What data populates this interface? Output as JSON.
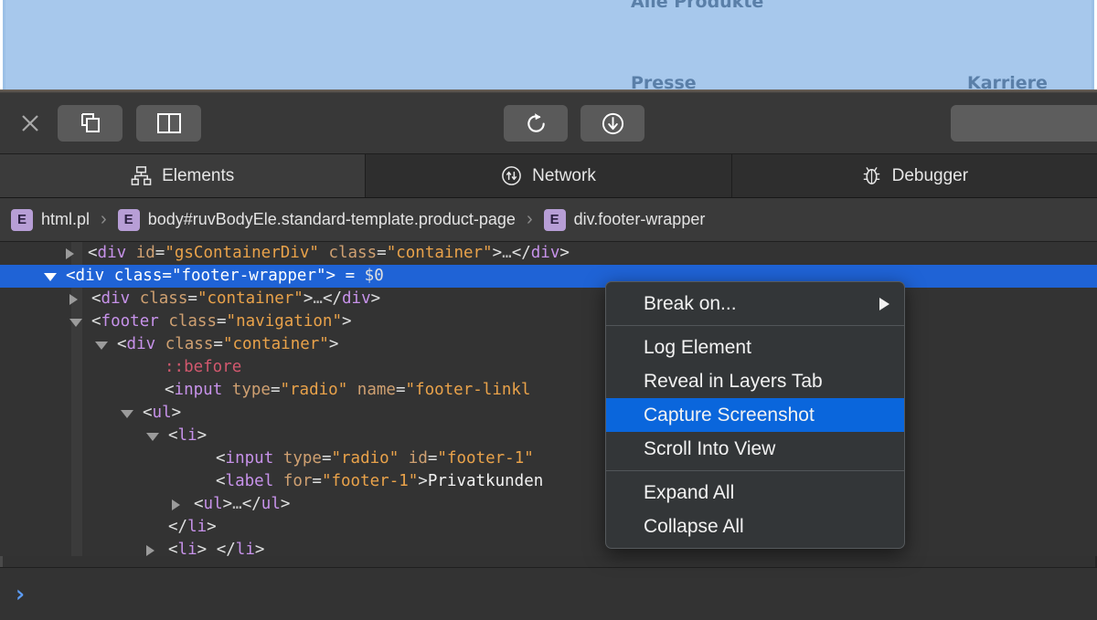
{
  "page": {
    "highlight_color": "#a7c8ec",
    "links": [
      {
        "label": "Alle Produkte"
      },
      {
        "label": "Presse"
      },
      {
        "label": "Karriere"
      }
    ]
  },
  "toolbar": {
    "close_label": "close-inspector",
    "dock_right_label": "dock-to-side",
    "dock_bottom_label": "dock-to-bottom",
    "reload_label": "reload-page",
    "download_label": "download-web-archive",
    "search_value": "",
    "search_placeholder": ""
  },
  "tabs": [
    {
      "label": "Elements",
      "icon": "elements-tree-icon",
      "active": true
    },
    {
      "label": "Network",
      "icon": "network-arrows-icon",
      "active": false
    },
    {
      "label": "Debugger",
      "icon": "bug-icon",
      "active": false
    }
  ],
  "breadcrumb": {
    "badge": "E",
    "items": [
      {
        "label": "html.pl"
      },
      {
        "label": "body#ruvBodyEle.standard-template.product-page"
      },
      {
        "label": "div.footer-wrapper"
      }
    ],
    "separator": "›"
  },
  "dom_tree": {
    "rows": [
      {
        "indent": 96,
        "twisty": "closed",
        "selected": false,
        "segments": [
          {
            "t": "punct",
            "v": "<"
          },
          {
            "t": "tag",
            "v": "div"
          },
          {
            "t": "punct",
            "v": " "
          },
          {
            "t": "attr",
            "v": "id"
          },
          {
            "t": "punct",
            "v": "="
          },
          {
            "t": "val",
            "v": "\"gsContainerDiv\""
          },
          {
            "t": "punct",
            "v": " "
          },
          {
            "t": "attr",
            "v": "class"
          },
          {
            "t": "punct",
            "v": "="
          },
          {
            "t": "val",
            "v": "\"container\""
          },
          {
            "t": "punct",
            "v": ">"
          },
          {
            "t": "ellip",
            "v": "…"
          },
          {
            "t": "punct",
            "v": "</"
          },
          {
            "t": "tag",
            "v": "div"
          },
          {
            "t": "punct",
            "v": ">"
          }
        ]
      },
      {
        "indent": 72,
        "twisty": "open",
        "selected": true,
        "segments": [
          {
            "t": "punct",
            "v": "<"
          },
          {
            "t": "tag",
            "v": "div"
          },
          {
            "t": "punct",
            "v": " "
          },
          {
            "t": "attr",
            "v": "class"
          },
          {
            "t": "punct",
            "v": "="
          },
          {
            "t": "val",
            "v": "\"footer-wrapper\""
          },
          {
            "t": "punct",
            "v": "> = "
          },
          {
            "t": "dollar",
            "v": "$0"
          }
        ]
      },
      {
        "indent": 100,
        "twisty": "closed",
        "selected": false,
        "segments": [
          {
            "t": "punct",
            "v": "<"
          },
          {
            "t": "tag",
            "v": "div"
          },
          {
            "t": "punct",
            "v": " "
          },
          {
            "t": "attr",
            "v": "class"
          },
          {
            "t": "punct",
            "v": "="
          },
          {
            "t": "val",
            "v": "\"container\""
          },
          {
            "t": "punct",
            "v": ">"
          },
          {
            "t": "ellip",
            "v": "…"
          },
          {
            "t": "punct",
            "v": "</"
          },
          {
            "t": "tag",
            "v": "div"
          },
          {
            "t": "punct",
            "v": ">"
          }
        ]
      },
      {
        "indent": 100,
        "twisty": "open",
        "selected": false,
        "segments": [
          {
            "t": "punct",
            "v": "<"
          },
          {
            "t": "tag",
            "v": "footer"
          },
          {
            "t": "punct",
            "v": " "
          },
          {
            "t": "attr",
            "v": "class"
          },
          {
            "t": "punct",
            "v": "="
          },
          {
            "t": "val",
            "v": "\"navigation\""
          },
          {
            "t": "punct",
            "v": ">"
          }
        ]
      },
      {
        "indent": 128,
        "twisty": "open",
        "selected": false,
        "segments": [
          {
            "t": "punct",
            "v": "<"
          },
          {
            "t": "tag",
            "v": "div"
          },
          {
            "t": "punct",
            "v": " "
          },
          {
            "t": "attr",
            "v": "class"
          },
          {
            "t": "punct",
            "v": "="
          },
          {
            "t": "val",
            "v": "\"container\""
          },
          {
            "t": "punct",
            "v": ">"
          }
        ]
      },
      {
        "indent": 180,
        "twisty": "none",
        "selected": false,
        "segments": [
          {
            "t": "pseudo",
            "v": "::before"
          }
        ]
      },
      {
        "indent": 180,
        "twisty": "none",
        "selected": false,
        "segments": [
          {
            "t": "punct",
            "v": "<"
          },
          {
            "t": "tag",
            "v": "input"
          },
          {
            "t": "punct",
            "v": " "
          },
          {
            "t": "attr",
            "v": "type"
          },
          {
            "t": "punct",
            "v": "="
          },
          {
            "t": "val",
            "v": "\"radio\""
          },
          {
            "t": "punct",
            "v": " "
          },
          {
            "t": "attr",
            "v": "name"
          },
          {
            "t": "punct",
            "v": "="
          },
          {
            "t": "val",
            "v": "\"footer-linkl"
          }
        ]
      },
      {
        "indent": 156,
        "twisty": "open",
        "selected": false,
        "segments": [
          {
            "t": "punct",
            "v": "<"
          },
          {
            "t": "tag",
            "v": "ul"
          },
          {
            "t": "punct",
            "v": ">"
          }
        ]
      },
      {
        "indent": 184,
        "twisty": "open",
        "selected": false,
        "segments": [
          {
            "t": "punct",
            "v": "<"
          },
          {
            "t": "tag",
            "v": "li"
          },
          {
            "t": "punct",
            "v": ">"
          }
        ]
      },
      {
        "indent": 236,
        "twisty": "none",
        "selected": false,
        "segments": [
          {
            "t": "punct",
            "v": "<"
          },
          {
            "t": "tag",
            "v": "input"
          },
          {
            "t": "punct",
            "v": " "
          },
          {
            "t": "attr",
            "v": "type"
          },
          {
            "t": "punct",
            "v": "="
          },
          {
            "t": "val",
            "v": "\"radio\""
          },
          {
            "t": "punct",
            "v": " "
          },
          {
            "t": "attr",
            "v": "id"
          },
          {
            "t": "punct",
            "v": "="
          },
          {
            "t": "val",
            "v": "\"footer-1\""
          }
        ]
      },
      {
        "indent": 236,
        "twisty": "none",
        "selected": false,
        "segments": [
          {
            "t": "punct",
            "v": "<"
          },
          {
            "t": "tag",
            "v": "label"
          },
          {
            "t": "punct",
            "v": " "
          },
          {
            "t": "attr",
            "v": "for"
          },
          {
            "t": "punct",
            "v": "="
          },
          {
            "t": "val",
            "v": "\"footer-1\""
          },
          {
            "t": "punct",
            "v": ">"
          },
          {
            "t": "txt",
            "v": "Privatkunden"
          }
        ]
      },
      {
        "indent": 212,
        "twisty": "closed",
        "selected": false,
        "segments": [
          {
            "t": "punct",
            "v": "<"
          },
          {
            "t": "tag",
            "v": "ul"
          },
          {
            "t": "punct",
            "v": ">"
          },
          {
            "t": "ellip",
            "v": "…"
          },
          {
            "t": "punct",
            "v": "</"
          },
          {
            "t": "tag",
            "v": "ul"
          },
          {
            "t": "punct",
            "v": ">"
          }
        ]
      },
      {
        "indent": 184,
        "twisty": "none",
        "selected": false,
        "segments": [
          {
            "t": "punct",
            "v": "</"
          },
          {
            "t": "tag",
            "v": "li"
          },
          {
            "t": "punct",
            "v": ">"
          }
        ]
      },
      {
        "indent": 184,
        "twisty": "closed",
        "selected": false,
        "segments": [
          {
            "t": "punct",
            "v": "<"
          },
          {
            "t": "tag",
            "v": "li"
          },
          {
            "t": "punct",
            "v": "> </"
          },
          {
            "t": "tag",
            "v": "li"
          },
          {
            "t": "punct",
            "v": ">"
          }
        ]
      }
    ]
  },
  "context_menu": {
    "items": [
      {
        "label": "Break on...",
        "has_submenu": true,
        "highlight": false
      },
      {
        "separator": true
      },
      {
        "label": "Log Element",
        "has_submenu": false,
        "highlight": false
      },
      {
        "label": "Reveal in Layers Tab",
        "has_submenu": false,
        "highlight": false
      },
      {
        "label": "Capture Screenshot",
        "has_submenu": false,
        "highlight": true
      },
      {
        "label": "Scroll Into View",
        "has_submenu": false,
        "highlight": false
      },
      {
        "separator": true
      },
      {
        "label": "Expand All",
        "has_submenu": false,
        "highlight": false
      },
      {
        "label": "Collapse All",
        "has_submenu": false,
        "highlight": false
      }
    ],
    "highlight_color": "#0a66dc"
  },
  "console": {
    "prompt": "›",
    "value": "",
    "placeholder": ""
  }
}
